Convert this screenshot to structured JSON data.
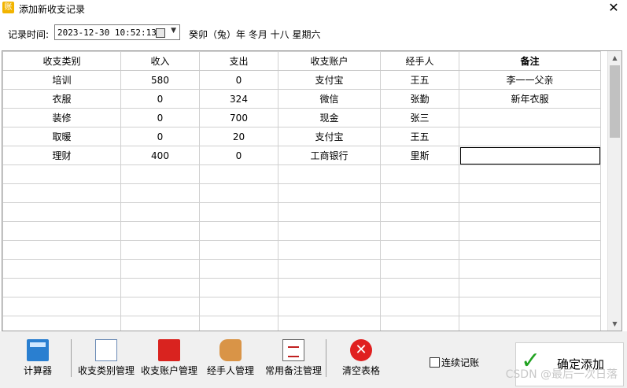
{
  "window": {
    "title": "添加新收支记录",
    "icon_text": "账",
    "close": "✕"
  },
  "time_row": {
    "label": "记录时间:",
    "value": "2023-12-30 10:52:13",
    "lunar": "癸卯（兔）年 冬月 十八 星期六"
  },
  "table": {
    "headers": [
      "收支类别",
      "收入",
      "支出",
      "收支账户",
      "经手人",
      "备注"
    ],
    "rows": [
      [
        "培训",
        "580",
        "0",
        "支付宝",
        "王五",
        "李一一父亲"
      ],
      [
        "衣服",
        "0",
        "324",
        "微信",
        "张勤",
        "新年衣服"
      ],
      [
        "装修",
        "0",
        "700",
        "现金",
        "张三",
        ""
      ],
      [
        "取暖",
        "0",
        "20",
        "支付宝",
        "王五",
        ""
      ],
      [
        "理财",
        "400",
        "0",
        "工商银行",
        "里斯",
        ""
      ]
    ]
  },
  "toolbar": {
    "calculator": "计算器",
    "category_mgmt": "收支类别管理",
    "account_mgmt": "收支账户管理",
    "handler_mgmt": "经手人管理",
    "note_mgmt": "常用备注管理",
    "clear_table": "清空表格",
    "continuous": "连续记账",
    "confirm": "确定添加"
  },
  "watermark": "CSDN @最后一次日落",
  "icons": [
    "calculator-icon",
    "checklist-icon",
    "book-icon",
    "hand-pointer-icon",
    "note-icon",
    "clear-icon",
    "checkmark-icon"
  ]
}
